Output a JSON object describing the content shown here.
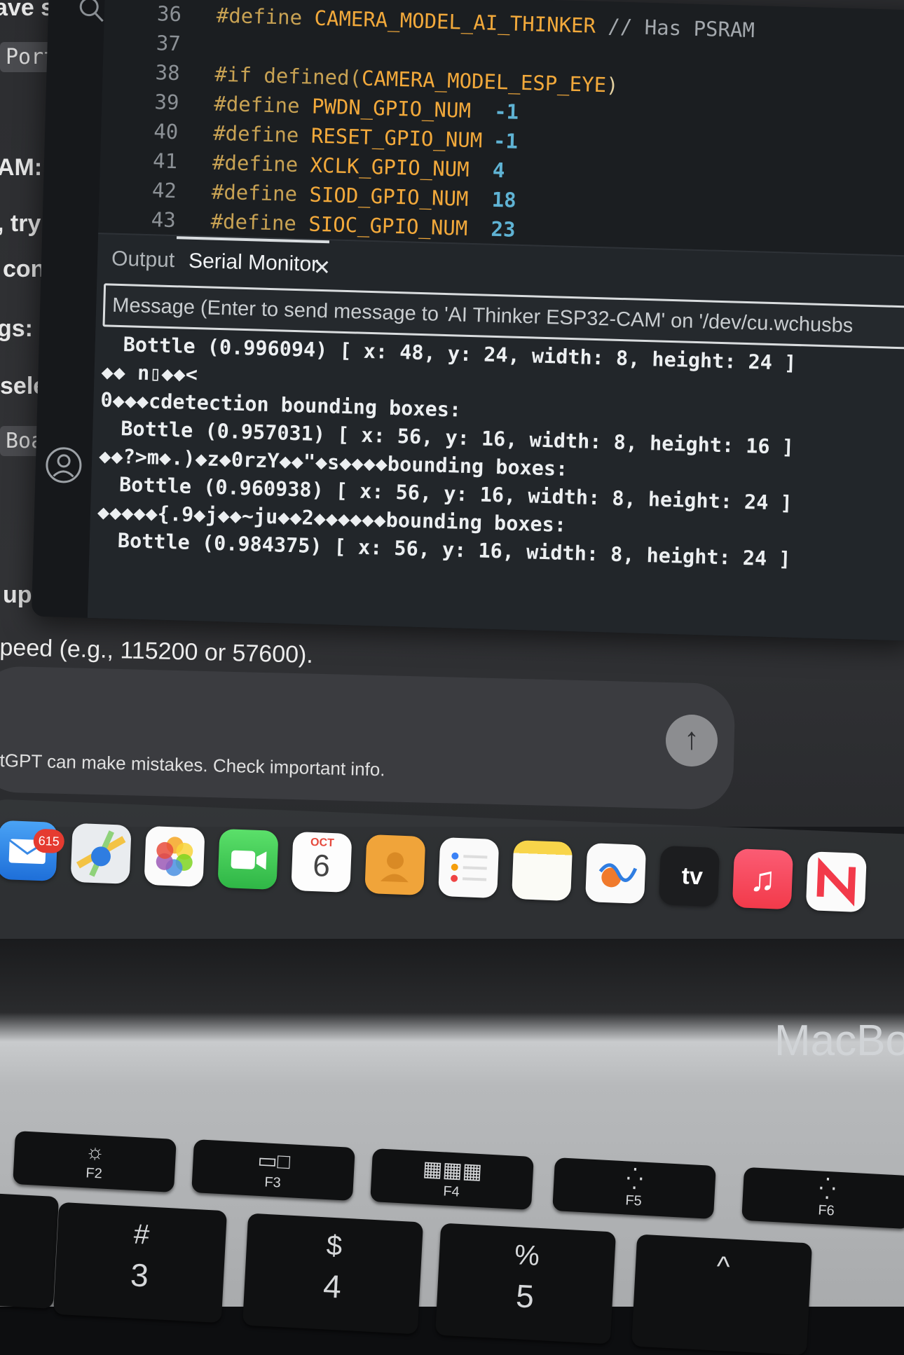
{
  "background_chat": {
    "fragments": [
      "ave s",
      "Port",
      "AM:",
      ", try",
      "conn",
      "gs:",
      "selec",
      "Boar",
      "uplo"
    ],
    "note": "peed (e.g., 115200 or 57600).",
    "disclaimer": "tGPT can make mistakes. Check important info."
  },
  "editor": {
    "lines": [
      {
        "num": "36",
        "kw": "#define",
        "name": "CAMERA_MODEL_AI_THINKER",
        "val": "",
        "comment": "// Has PSRAM"
      },
      {
        "num": "37",
        "kw": "",
        "name": "",
        "val": "",
        "comment": ""
      },
      {
        "num": "38",
        "kw": "#if defined(",
        "name": "CAMERA_MODEL_ESP_EYE",
        "val": ")",
        "comment": ""
      },
      {
        "num": "39",
        "kw": "#define",
        "name": "PWDN_GPIO_NUM",
        "val": "-1",
        "comment": ""
      },
      {
        "num": "40",
        "kw": "#define",
        "name": "RESET_GPIO_NUM",
        "val": "-1",
        "comment": ""
      },
      {
        "num": "41",
        "kw": "#define",
        "name": "XCLK_GPIO_NUM",
        "val": "4",
        "comment": ""
      },
      {
        "num": "42",
        "kw": "#define",
        "name": "SIOD_GPIO_NUM",
        "val": "18",
        "comment": ""
      },
      {
        "num": "43",
        "kw": "#define",
        "name": "SIOC_GPIO_NUM",
        "val": "23",
        "comment": ""
      }
    ]
  },
  "panel": {
    "tabs": {
      "output": "Output",
      "serial": "Serial Monitor"
    },
    "close_glyph": "✕",
    "input_placeholder": "Message (Enter to send message to 'AI Thinker ESP32-CAM' on '/dev/cu.wchusbs"
  },
  "serial_output": [
    "Bottle (0.996094) [ x: 48, y: 24, width: 8, height: 24 ]",
    "◆◆ n▯◆◆<",
    "0◆◆◆cdetection bounding boxes:",
    "Bottle (0.957031) [ x: 56, y: 16, width: 8, height: 16 ]",
    "◆◆?>m◆.)◆z◆0rzY◆◆\"◆s◆◆◆◆bounding boxes:",
    "Bottle (0.960938) [ x: 56, y: 16, width: 8, height: 24 ]",
    "◆◆◆◆◆{.9◆j◆◆~ju◆◆2◆◆◆◆◆◆bounding boxes:",
    "Bottle (0.984375) [ x: 56, y: 16, width: 8, height: 24 ]"
  ],
  "dock": {
    "mail_badge": "615",
    "calendar_month": "OCT",
    "calendar_day": "6",
    "tv_label": " tv",
    "music_glyph": "♫"
  },
  "laptop": {
    "brand_label": "MacBo",
    "fkeys": [
      "F2",
      "F3",
      "F4",
      "F5",
      "F6"
    ],
    "numkeys": [
      {
        "sym": "#",
        "num": "3"
      },
      {
        "sym": "$",
        "num": "4"
      },
      {
        "sym": "%",
        "num": "5"
      }
    ],
    "caret_key": "^"
  },
  "colors": {
    "macro": "#f2a93b",
    "number": "#5fb3d4",
    "badge": "#e53b30"
  }
}
